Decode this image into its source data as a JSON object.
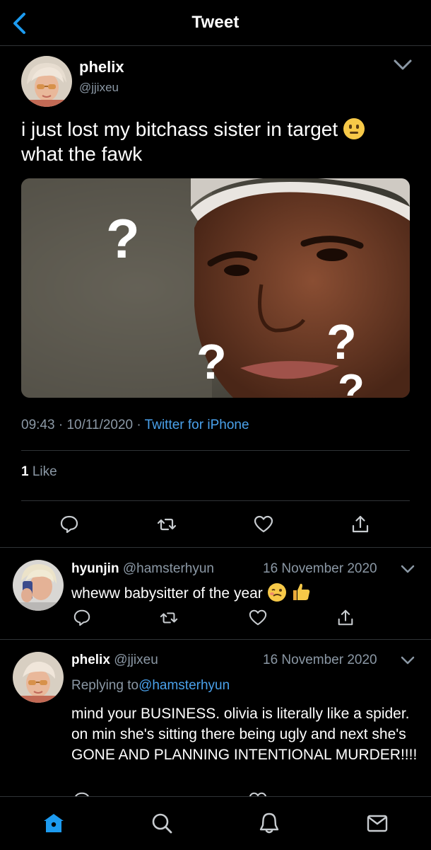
{
  "header": {
    "title": "Tweet",
    "back_icon": "chevron-left-icon"
  },
  "tweet": {
    "name": "phelix",
    "handle": "@jjixeu",
    "text": "i just lost my bitchass sister in target",
    "text_line2": "what the fawk",
    "emoji": "neutral-face-emoji",
    "time": "09:43",
    "date": "10/11/2020",
    "source": "Twitter for iPhone",
    "like_count": "1",
    "like_label": "Like",
    "media": {
      "marks": [
        "?",
        "?",
        "?",
        "?"
      ]
    }
  },
  "replies": [
    {
      "name": "hyunjin",
      "handle": "@hamsterhyun",
      "date": "16 November 2020",
      "text": "wheww babysitter of the year",
      "emojis": [
        "woozy-face-emoji",
        "thumbs-up-emoji"
      ]
    },
    {
      "name": "phelix",
      "handle": "@jjixeu",
      "date": "16 November 2020",
      "replying_label": "Replying to",
      "replying_to": "@hamsterhyun",
      "text": "mind your BUSINESS. olivia is literally like a spider. on min she's sitting there being ugly and next she's GONE AND PLANNING INTENTIONAL MURDER!!!!"
    }
  ],
  "actions": [
    "reply-icon",
    "retweet-icon",
    "like-icon",
    "share-icon"
  ],
  "tabbar": [
    "home-icon",
    "search-icon",
    "notifications-icon",
    "messages-icon"
  ],
  "colors": {
    "accent": "#1d9bf0",
    "link": "#4aa1eb",
    "muted": "#8b98a5",
    "divider": "#2f3336"
  }
}
